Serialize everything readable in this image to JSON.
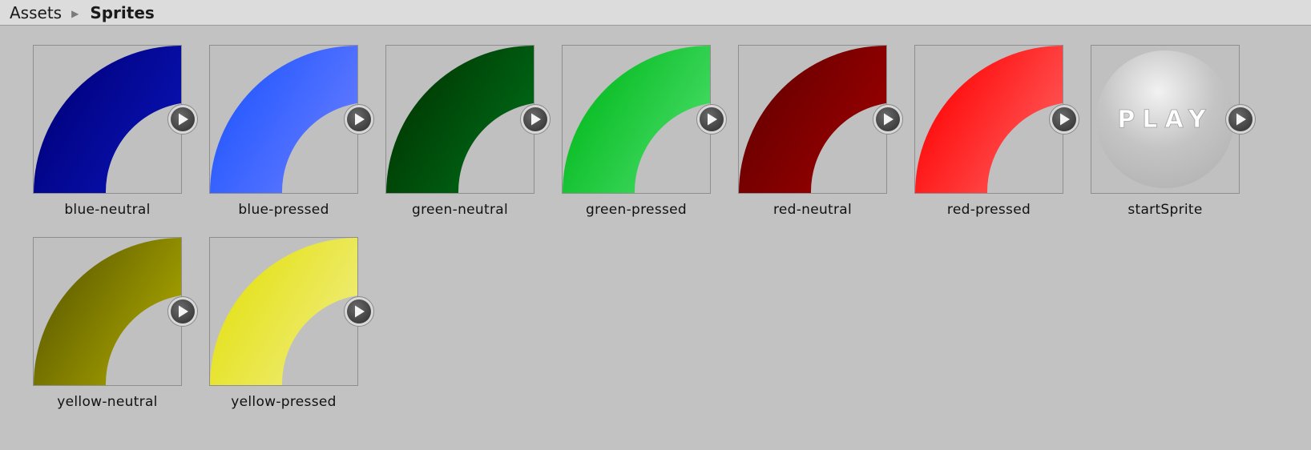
{
  "breadcrumb": {
    "root": "Assets",
    "current": "Sprites"
  },
  "assets": [
    {
      "name": "blue-neutral",
      "kind": "arc",
      "dark": "#00007a",
      "light": "#0a14b8"
    },
    {
      "name": "blue-pressed",
      "kind": "arc",
      "dark": "#1f55ff",
      "light": "#6b7fff"
    },
    {
      "name": "green-neutral",
      "kind": "arc",
      "dark": "#003500",
      "light": "#00701a"
    },
    {
      "name": "green-pressed",
      "kind": "arc",
      "dark": "#00b81a",
      "light": "#4fe070"
    },
    {
      "name": "red-neutral",
      "kind": "arc",
      "dark": "#650000",
      "light": "#a00000"
    },
    {
      "name": "red-pressed",
      "kind": "arc",
      "dark": "#ff0000",
      "light": "#ff6464"
    },
    {
      "name": "startSprite",
      "kind": "sphere",
      "text": "PLAY"
    },
    {
      "name": "yellow-neutral",
      "kind": "arc",
      "dark": "#5c5a00",
      "light": "#b0ac00"
    },
    {
      "name": "yellow-pressed",
      "kind": "arc",
      "dark": "#e4e010",
      "light": "#f0ee86"
    }
  ],
  "icons": {
    "expand": "play-icon"
  }
}
